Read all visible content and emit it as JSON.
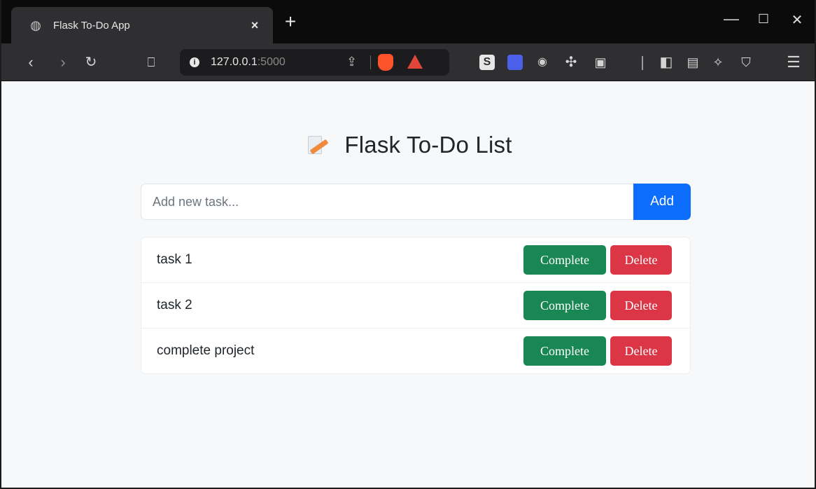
{
  "browser": {
    "tab_title": "Flask To-Do App",
    "tab_close": "×",
    "new_tab": "+",
    "url_host": "127.0.0.1",
    "url_port": ":5000",
    "controls": {
      "minimize": "—",
      "maximize": "☐",
      "close": "✕"
    },
    "icons": [
      "back-icon",
      "forward-icon",
      "reload-icon",
      "bookmark-icon",
      "info-icon",
      "share-icon",
      "brave-shield-icon",
      "brave-rewards-icon",
      "extension-s-icon",
      "extension-blue-icon",
      "extension-camera-icon",
      "extensions-puzzle-icon",
      "screenshot-icon",
      "sidebar-icon",
      "wallet-icon",
      "leo-icon",
      "vpn-icon",
      "menu-icon"
    ]
  },
  "page": {
    "heading": "Flask To-Do List",
    "input_placeholder": "Add new task...",
    "add_label": "Add",
    "tasks": [
      {
        "text": "task 1",
        "complete_label": "Complete",
        "delete_label": "Delete"
      },
      {
        "text": "task 2",
        "complete_label": "Complete",
        "delete_label": "Delete"
      },
      {
        "text": "complete project",
        "complete_label": "Complete",
        "delete_label": "Delete"
      }
    ]
  },
  "colors": {
    "primary": "#0d6efd",
    "success": "#198754",
    "danger": "#dc3545",
    "page_bg": "#f7f8fa",
    "browser_chrome": "#2f2f32"
  }
}
